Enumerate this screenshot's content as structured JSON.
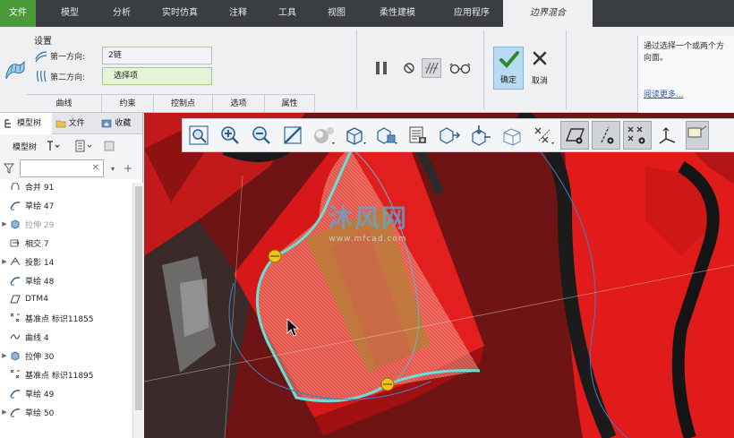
{
  "tabs": [
    {
      "label": "文件"
    },
    {
      "label": "模型"
    },
    {
      "label": "分析"
    },
    {
      "label": "实时仿真"
    },
    {
      "label": "注释"
    },
    {
      "label": "工具"
    },
    {
      "label": "视图"
    },
    {
      "label": "柔性建模"
    },
    {
      "label": "应用程序"
    },
    {
      "label": "边界混合"
    }
  ],
  "ribbon": {
    "settings_title": "设置",
    "first_direction_label": "第一方向:",
    "first_direction_value": "2链",
    "second_direction_label": "第二方向:",
    "second_direction_value": "选择项",
    "subtabs": [
      "曲线",
      "约束",
      "控制点",
      "选项",
      "属性"
    ],
    "ok_label": "确定",
    "cancel_label": "取消",
    "help_text": "通过选择一个或两个方向面。",
    "help_link": "阅读更多..."
  },
  "left_panel": {
    "tabs": [
      "模型树",
      "文件",
      "收藏"
    ],
    "toolbar_label": "模型树",
    "filter_placeholder": "",
    "tree_items": [
      {
        "label": "合并 91",
        "expandable": false,
        "icon": "merge-icon",
        "dim": false
      },
      {
        "label": "草绘 47",
        "expandable": false,
        "icon": "sketch-icon",
        "dim": false
      },
      {
        "label": "拉伸 29",
        "expandable": true,
        "icon": "extrude-icon",
        "dim": true
      },
      {
        "label": "相交 7",
        "expandable": false,
        "icon": "intersect-icon",
        "dim": false
      },
      {
        "label": "投影 14",
        "expandable": true,
        "icon": "project-icon",
        "dim": false
      },
      {
        "label": "草绘 48",
        "expandable": false,
        "icon": "sketch-icon",
        "dim": false
      },
      {
        "label": "DTM4",
        "expandable": false,
        "icon": "datum-plane-icon",
        "dim": false
      },
      {
        "label": "基准点 标识11855",
        "expandable": false,
        "icon": "datum-point-icon",
        "dim": false
      },
      {
        "label": "曲线 4",
        "expandable": false,
        "icon": "curve-icon",
        "dim": false
      },
      {
        "label": "拉伸 30",
        "expandable": true,
        "icon": "extrude-icon",
        "dim": false
      },
      {
        "label": "基准点 标识11895",
        "expandable": false,
        "icon": "datum-point-icon",
        "dim": false
      },
      {
        "label": "草绘 49",
        "expandable": false,
        "icon": "sketch-icon",
        "dim": false
      },
      {
        "label": "草绘 50",
        "expandable": true,
        "icon": "sketch-icon",
        "dim": false
      }
    ]
  },
  "viewport": {
    "watermark_main": "沐风网",
    "watermark_sub": "www.mfcad.com"
  },
  "colors": {
    "accent_green": "#4a9b38",
    "model_red": "#e01818",
    "boundary_surface": "#e3b07a",
    "boundary_curve": "#68e0d8"
  }
}
